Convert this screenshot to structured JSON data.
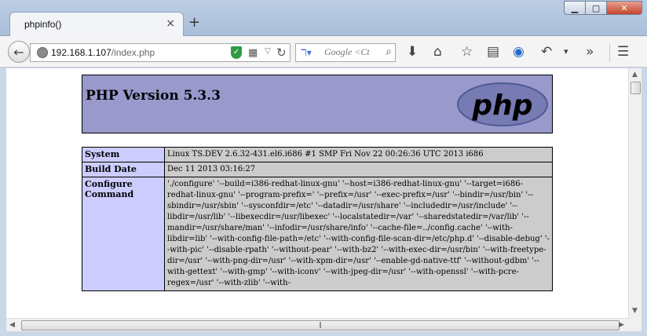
{
  "browser": {
    "tab_title": "phpinfo()",
    "tab_close": "×",
    "new_tab": "+",
    "window_buttons": {
      "minimize": "▁",
      "maximize": "▢",
      "close": "✕"
    },
    "url_host": "192.168.1.107",
    "url_path": "/index.php",
    "search_placeholder": "Google <Ct",
    "search_engine_icon": "g-icon"
  },
  "page": {
    "title": "PHP Version 5.3.3",
    "logo_text": "php",
    "rows": [
      {
        "key": "System",
        "value": "Linux TS.DEV 2.6.32-431.el6.i686 #1 SMP Fri Nov 22 00:26:36 UTC 2013 i686"
      },
      {
        "key": "Build Date",
        "value": "Dec 11 2013 03:16:27"
      },
      {
        "key": "Configure Command",
        "value": "'./configure' '--build=i386-redhat-linux-gnu' '--host=i386-redhat-linux-gnu' '--target=i686-redhat-linux-gnu' '--program-prefix=' '--prefix=/usr' '--exec-prefix=/usr' '--bindir=/usr/bin' '--sbindir=/usr/sbin' '--sysconfdir=/etc' '--datadir=/usr/share' '--includedir=/usr/include' '--libdir=/usr/lib' '--libexecdir=/usr/libexec' '--localstatedir=/var' '--sharedstatedir=/var/lib' '--mandir=/usr/share/man' '--infodir=/usr/share/info' '--cache-file=../config.cache' '--with-libdir=lib' '--with-config-file-path=/etc' '--with-config-file-scan-dir=/etc/php.d' '--disable-debug' '--with-pic' '--disable-rpath' '--without-pear' '--with-bz2' '--with-exec-dir=/usr/bin' '--with-freetype-dir=/usr' '--with-png-dir=/usr' '--with-xpm-dir=/usr' '--enable-gd-native-ttf' '--without-gdbm' '--with-gettext' '--with-gmp' '--with-iconv' '--with-jpeg-dir=/usr' '--with-openssl' '--with-pcre-regex=/usr' '--with-zlib' '--with-"
      }
    ]
  },
  "colors": {
    "header_bg": "#9999cc",
    "key_bg": "#ccccff",
    "value_bg": "#cccccc",
    "logo_fill": "#777bb3"
  }
}
